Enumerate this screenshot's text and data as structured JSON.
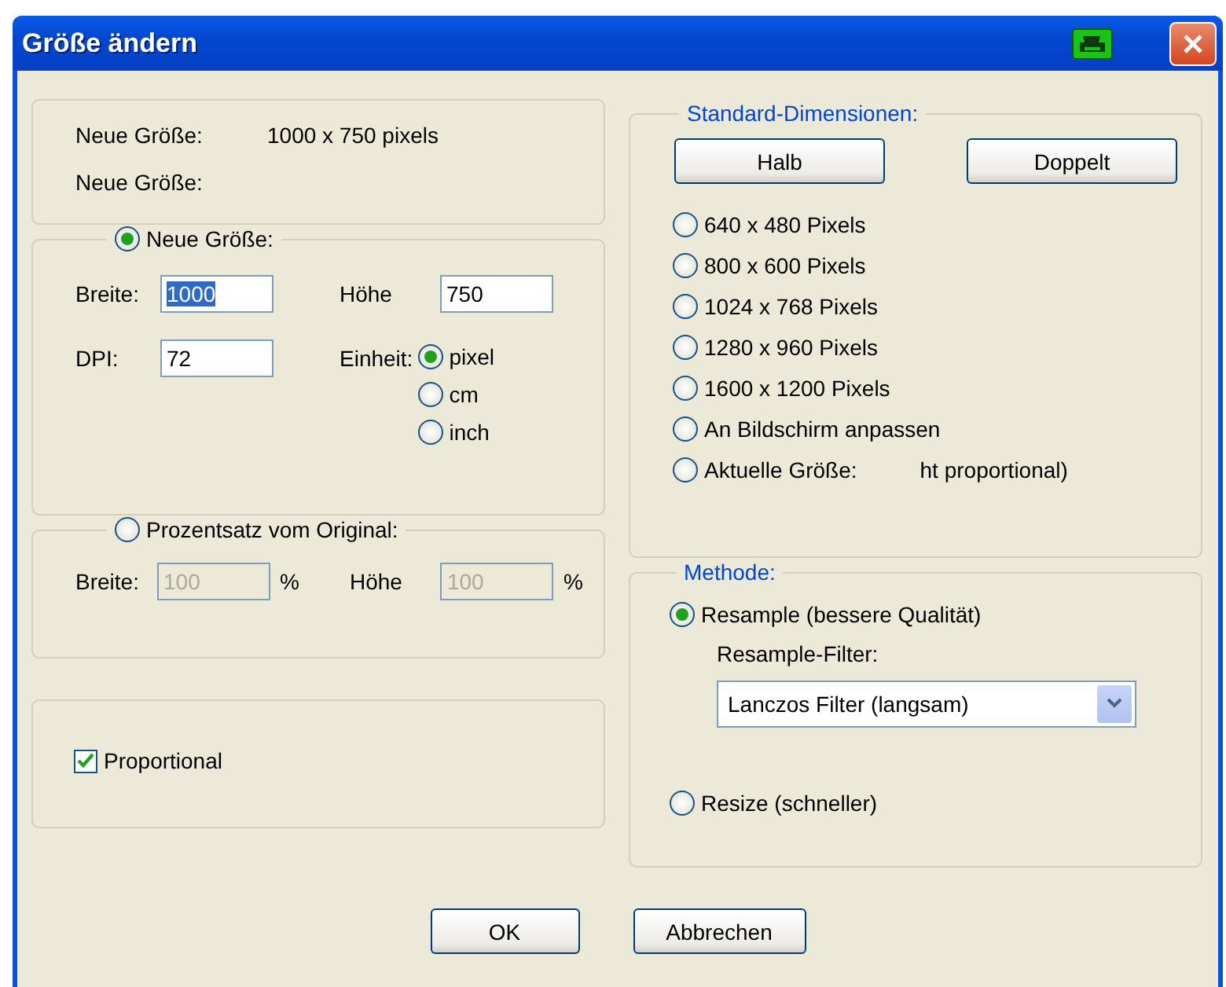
{
  "window": {
    "title": "Größe ändern"
  },
  "info": [
    {
      "label": "Neue Größe:",
      "value": "1000 x 750 pixels"
    },
    {
      "label": "Neue Größe:"
    }
  ],
  "new_size": {
    "label": "Neue Größe:",
    "selected": true,
    "width_label": "Breite:",
    "width_value": "1000",
    "width_value_highlighted": true,
    "height_label": "Höhe",
    "height_value": "750",
    "dpi_label": "DPI:",
    "dpi_value": "72",
    "unit_label": "Einheit:",
    "units": [
      {
        "label": "pixel",
        "selected": true
      },
      {
        "label": "cm",
        "selected": false
      },
      {
        "label": "inch",
        "selected": false
      }
    ]
  },
  "percent": {
    "label": "Prozentsatz vom Original:",
    "selected": false,
    "disabled": true,
    "width_label": "Breite:",
    "width_value": "100",
    "width_unit": "%",
    "height_label": "Höhe",
    "height_value": "100",
    "height_unit": "%"
  },
  "proportional": {
    "label": "Proportional",
    "checked": true
  },
  "standard": {
    "title": "Standard-Dimensionen:",
    "buttons": [
      "Halb",
      "Doppelt"
    ],
    "options": [
      {
        "label": "640 x 480 Pixels",
        "selected": false
      },
      {
        "label": "800 x 600 Pixels",
        "selected": false
      },
      {
        "label": "1024 x 768 Pixels",
        "selected": false
      },
      {
        "label": "1280 x 960 Pixels",
        "selected": false
      },
      {
        "label": "1600 x 1200 Pixels",
        "selected": false
      },
      {
        "label": "An Bildschirm anpassen",
        "selected": false
      },
      {
        "label": "Aktuelle Größe:",
        "selected": false,
        "note": "ht proportional)"
      }
    ]
  },
  "method": {
    "title": "Methode:",
    "options": [
      {
        "label": "Resample (bessere Qualität)",
        "selected": true,
        "filter_label": "Resample-Filter:",
        "filter_value": "Lanczos Filter (langsam)"
      },
      {
        "label": "Resize (schneller)",
        "selected": false
      }
    ]
  },
  "buttons": [
    "OK",
    "Abbrechen"
  ]
}
